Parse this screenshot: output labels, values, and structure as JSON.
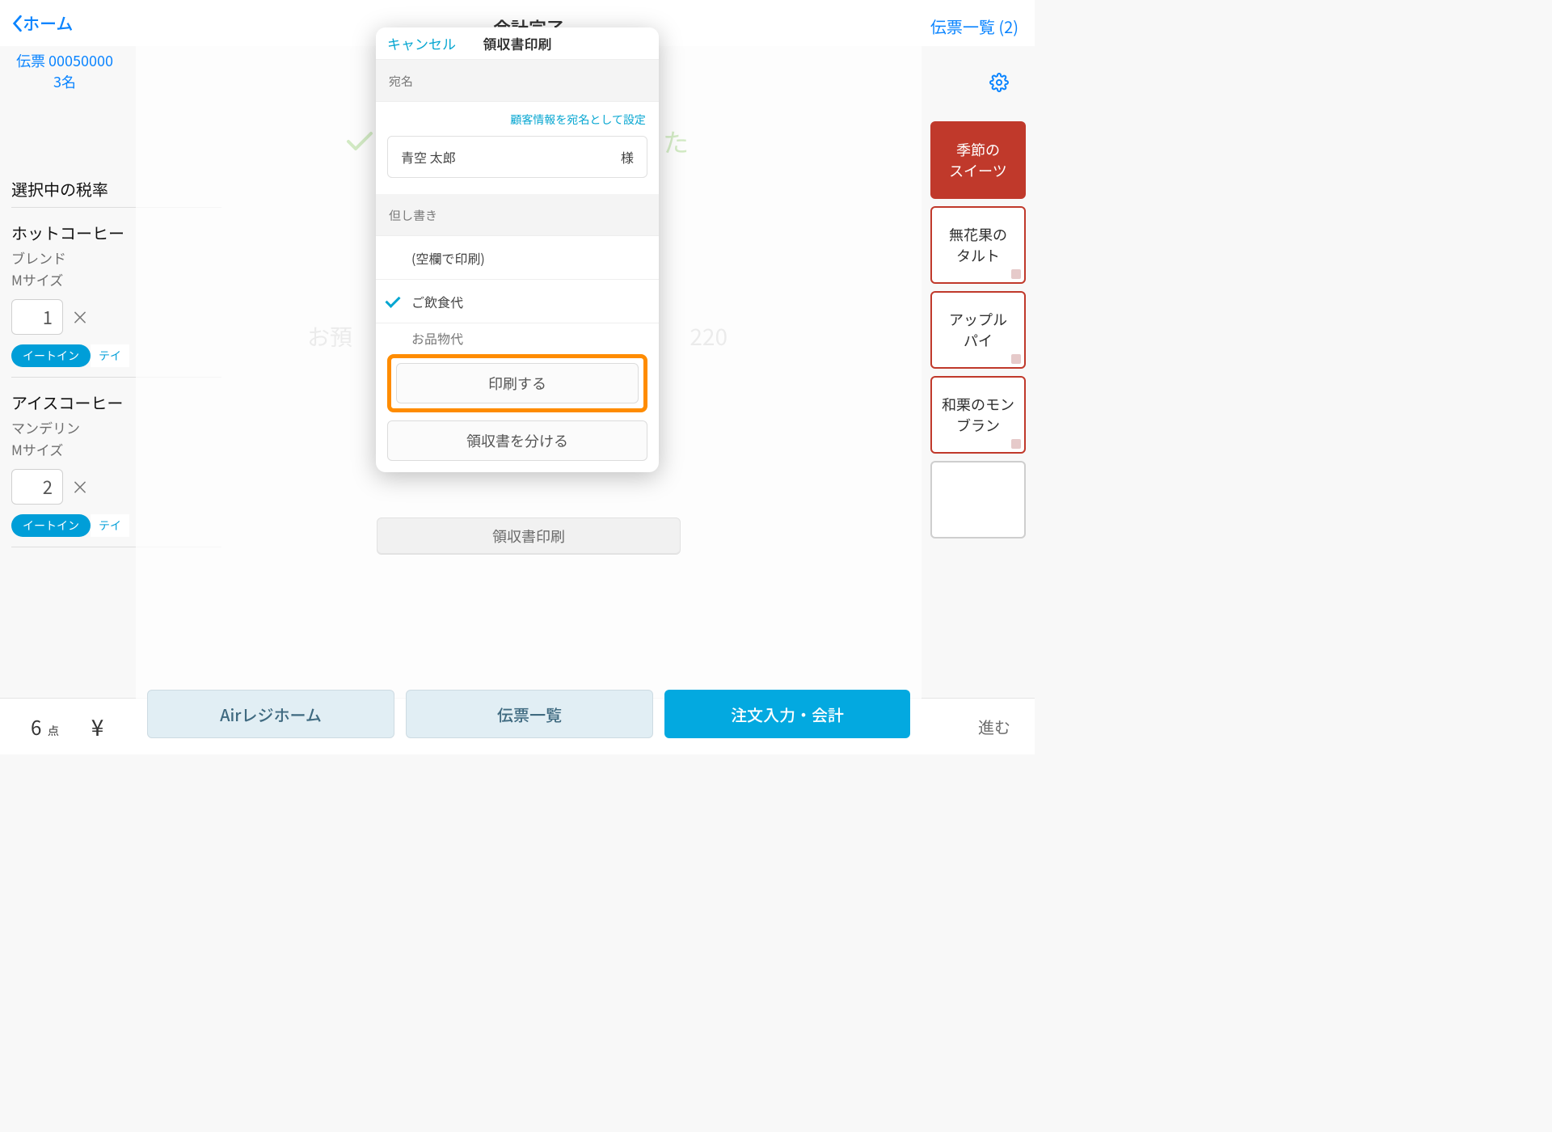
{
  "header": {
    "home": "ホーム",
    "slip_list": "伝票一覧 (2)"
  },
  "slip_info": {
    "number": "伝票 00050000",
    "guests": "3名"
  },
  "left_panel": {
    "tax_label": "選択中の税率",
    "item1_name": "ホットコーヒー",
    "item1_var": "ブレンド",
    "item1_size": "Mサイズ",
    "item1_qty": "1",
    "item2_name": "アイスコーヒー",
    "item2_var": "マンデリン",
    "item2_size": "Mサイズ",
    "item2_qty": "2",
    "tag_eatin": "イートイン",
    "tag_takeout": "テイ"
  },
  "right_cards": [
    "季節の\nスイーツ",
    "無花果の\nタルト",
    "アップル\nパイ",
    "和栗のモン\nブラン"
  ],
  "completion": {
    "title": "会計完了",
    "msg_suffix": "た",
    "deposit_label": "お預",
    "deposit_amount": "220"
  },
  "modal_buttons": {
    "air_home": "Airレジホーム",
    "slip_list": "伝票一覧",
    "order_entry": "注文入力・会計",
    "receipt_print": "領収書印刷"
  },
  "popover": {
    "cancel": "キャンセル",
    "title": "領収書印刷",
    "addressee_label": "宛名",
    "set_customer": "顧客情報を宛名として設定",
    "name_value": "青空 太郎",
    "honorific": "様",
    "memo_label": "但し書き",
    "memo_opt_blank": "(空欄で印刷)",
    "memo_opt_food": "ご飲食代",
    "memo_opt_goods": "お品物代",
    "btn_print": "印刷する",
    "btn_split": "領収書を分ける"
  },
  "footer": {
    "points": "6",
    "points_unit": "点",
    "yen": "¥",
    "advance": "進む"
  }
}
